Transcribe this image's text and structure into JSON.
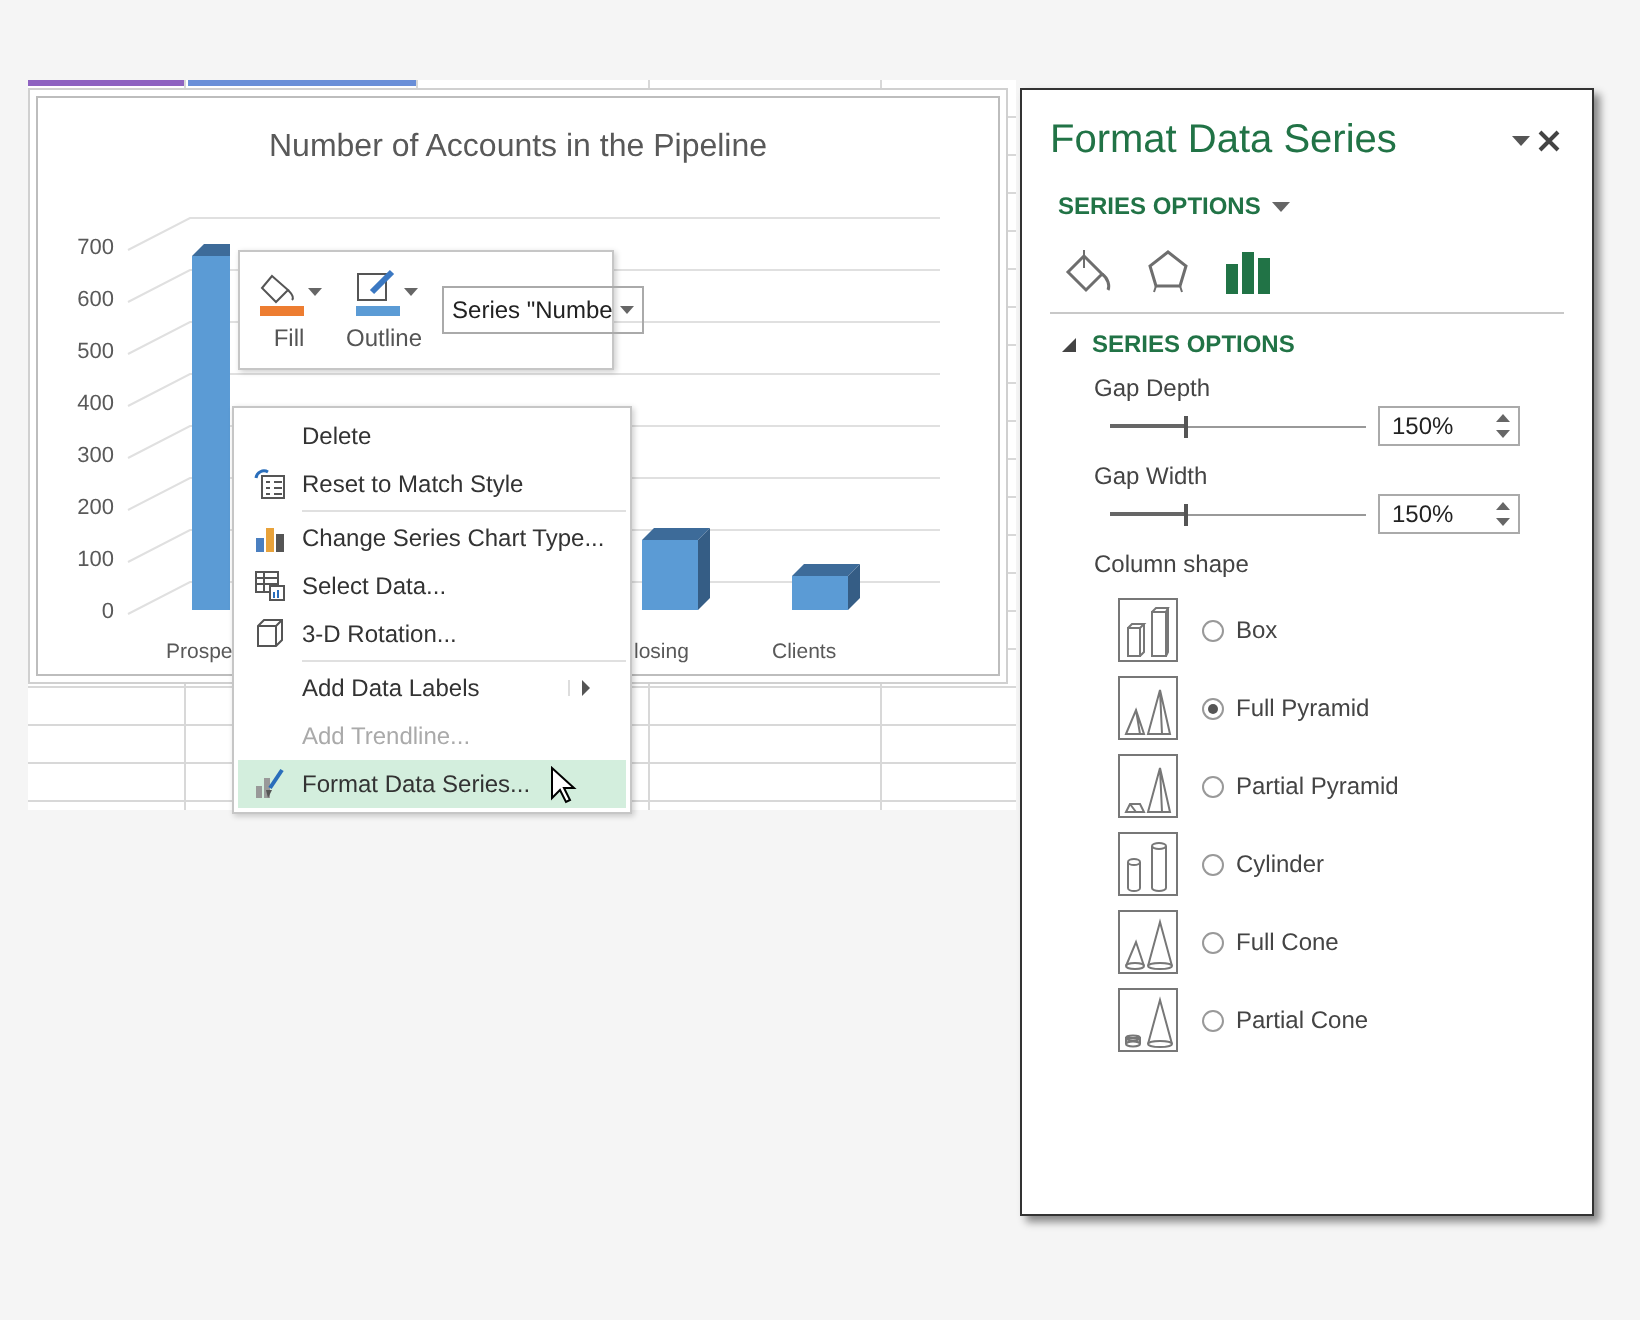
{
  "chart": {
    "title": "Number of Accounts in the Pipeline",
    "y_axis_labels": [
      "700",
      "600",
      "500",
      "400",
      "300",
      "200",
      "100",
      "0"
    ],
    "category_labels": [
      "Prospe",
      "losing",
      "Clients"
    ]
  },
  "mini_toolbar": {
    "buttons": [
      {
        "label": "Fill"
      },
      {
        "label": "Outline"
      }
    ],
    "series_select": "Series \"Numbe"
  },
  "context_menu": {
    "groups": [
      [
        {
          "label": "Delete",
          "disabled": false,
          "selected": false,
          "submenu": false
        },
        {
          "label": "Reset to Match Style",
          "disabled": false,
          "selected": false,
          "submenu": false
        }
      ],
      [
        {
          "label": "Change Series Chart Type...",
          "disabled": false,
          "selected": false,
          "submenu": false
        },
        {
          "label": "Select Data...",
          "disabled": false,
          "selected": false,
          "submenu": false
        },
        {
          "label": "3-D Rotation...",
          "disabled": false,
          "selected": false,
          "submenu": false
        }
      ],
      [
        {
          "label": "Add Data Labels",
          "disabled": false,
          "selected": false,
          "submenu": true
        },
        {
          "label": "Add Trendline...",
          "disabled": true,
          "selected": false,
          "submenu": false
        },
        {
          "label": "Format Data Series...",
          "disabled": false,
          "selected": true,
          "submenu": false
        }
      ]
    ]
  },
  "pane": {
    "title": "Format Data Series",
    "options_menu": "SERIES OPTIONS",
    "tabs": [
      {
        "selected": false
      },
      {
        "selected": false
      },
      {
        "selected": true
      }
    ],
    "section": {
      "title": "SERIES OPTIONS",
      "expanded": true
    },
    "sliders": [
      {
        "label": "Gap Depth",
        "level": 0.3,
        "value": "150%"
      },
      {
        "label": "Gap Width",
        "level": 0.3,
        "value": "150%"
      }
    ],
    "shape_label": "Column shape",
    "shapes": [
      {
        "label": "Box",
        "selected": false
      },
      {
        "label": "Full Pyramid",
        "selected": true
      },
      {
        "label": "Partial Pyramid",
        "selected": false
      },
      {
        "label": "Cylinder",
        "selected": false
      },
      {
        "label": "Full Cone",
        "selected": false
      },
      {
        "label": "Partial Cone",
        "selected": false
      }
    ]
  }
}
